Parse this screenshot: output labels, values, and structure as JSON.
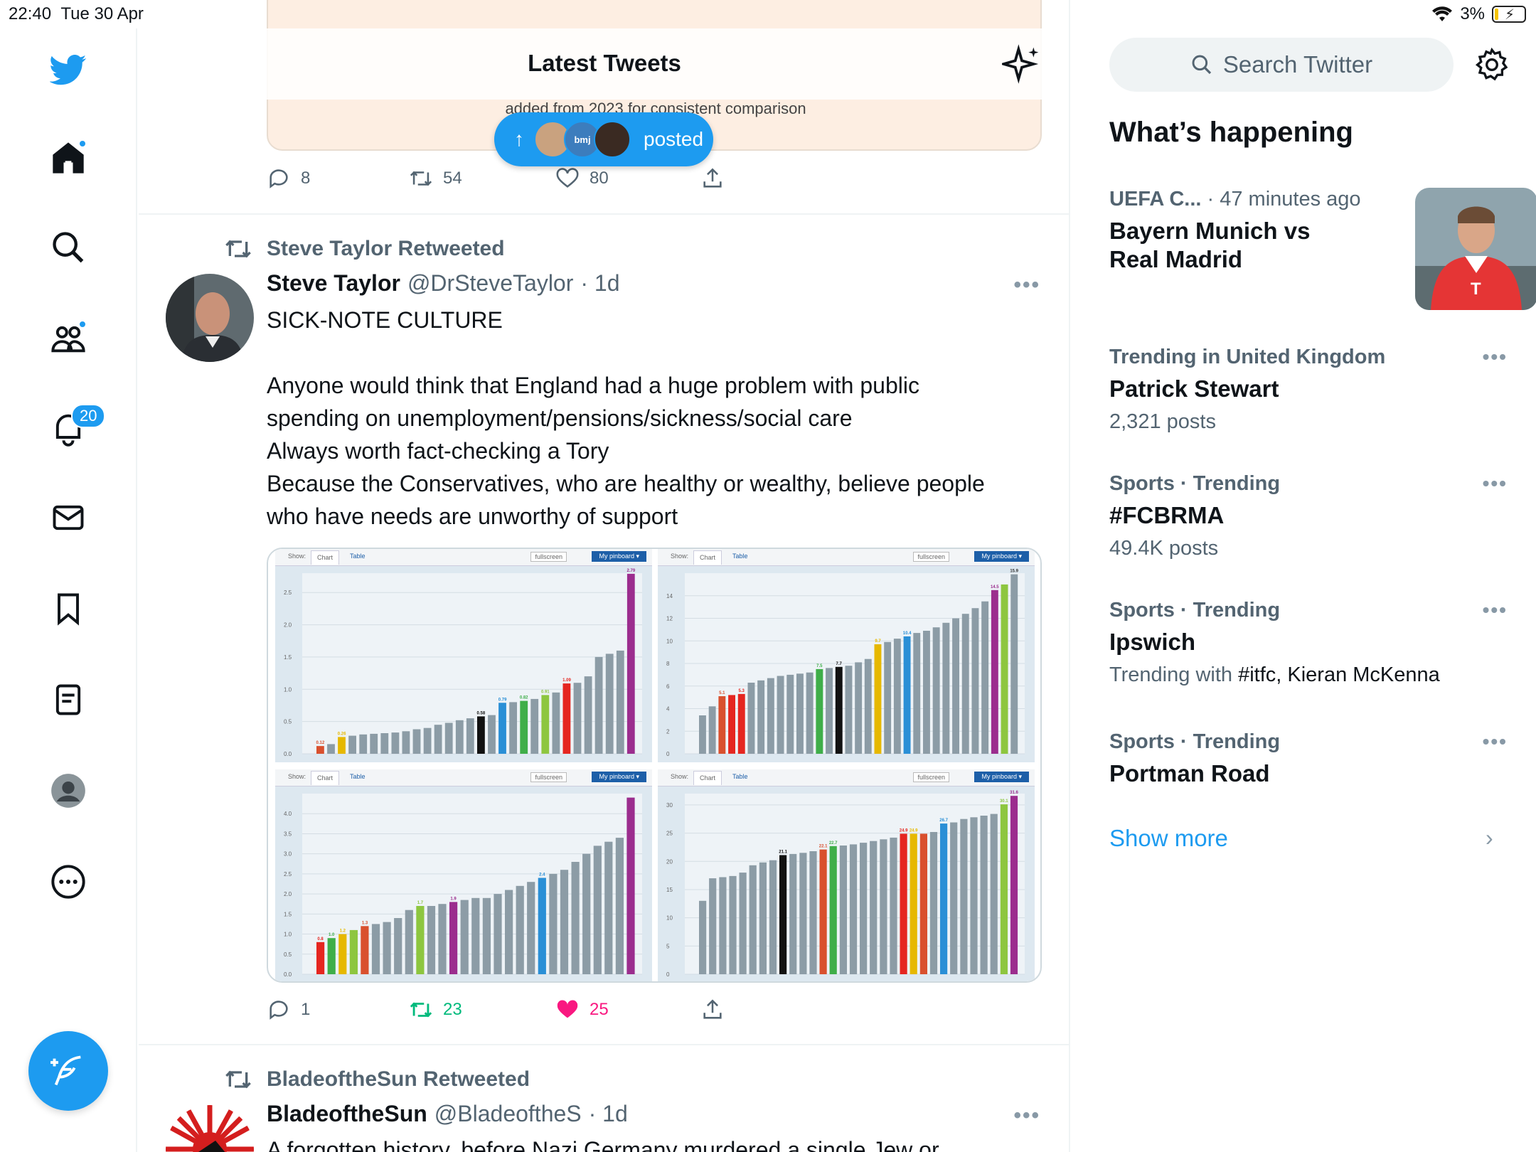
{
  "status": {
    "time": "22:40",
    "date": "Tue 30 Apr",
    "dots": "•••",
    "battery": "3%"
  },
  "nav": {
    "notifications_badge": "20"
  },
  "header": {
    "title": "Latest Tweets"
  },
  "previous_tweet": {
    "card_text": "added from 2023 for consistent comparison",
    "reply_count": "8",
    "retweet_count": "54",
    "like_count": "80"
  },
  "new_posts_pill": {
    "arrow": "↑",
    "label": "posted",
    "avatar_text": "bmj"
  },
  "tweet1": {
    "retweeted_by": "Steve Taylor Retweeted",
    "name": "Steve Taylor",
    "handle": "@DrSteveTaylor",
    "time": "· 1d",
    "more": "•••",
    "lines": [
      "SICK-NOTE CULTURE",
      "Anyone would think that England had a huge problem with public",
      "spending on unemployment/pensions/sickness/social care",
      "Always worth fact-checking a Tory",
      "Because the Conservatives, who are healthy or wealthy, believe people",
      "who have needs are unworthy of support"
    ],
    "reply_count": "1",
    "retweet_count": "23",
    "like_count": "25",
    "like_color": "#f91880",
    "retweet_color": "#00ba7c"
  },
  "chart_toolbar": {
    "show": "Show:",
    "chart": "Chart",
    "table": "Table",
    "fullscreen": "fullscreen",
    "pinboard": "My pinboard ▾"
  },
  "chart_data": [
    {
      "type": "bar",
      "values": [
        0.12,
        0.15,
        0.26,
        0.28,
        0.3,
        0.31,
        0.32,
        0.33,
        0.35,
        0.38,
        0.4,
        0.45,
        0.48,
        0.52,
        0.55,
        0.58,
        0.6,
        0.79,
        0.8,
        0.82,
        0.85,
        0.91,
        0.95,
        1.09,
        1.1,
        1.2,
        1.5,
        1.55,
        1.6,
        2.79
      ],
      "colors_index": {
        "0": "#d9502e",
        "2": "#e6b800",
        "15": "#111111",
        "17": "#2a8fd6",
        "19": "#3fae49",
        "21": "#8dc63f",
        "23": "#e52620",
        "29": "#9b2d8e"
      },
      "labels_index": {
        "0": "0.12",
        "2": "0.26",
        "15": "0.58",
        "17": "0.79",
        "19": "0.82",
        "21": "0.91",
        "23": "1.09",
        "29": "2.79"
      },
      "ylim": [
        0,
        2.8
      ],
      "yticks": [
        "0.0",
        "0.5",
        "1.0",
        "1.5",
        "2.0",
        "2.5"
      ]
    },
    {
      "type": "bar",
      "values": [
        3.4,
        4.2,
        5.1,
        5.2,
        5.3,
        6.3,
        6.5,
        6.7,
        6.9,
        7.0,
        7.1,
        7.2,
        7.5,
        7.6,
        7.7,
        7.8,
        8.1,
        8.4,
        9.7,
        9.9,
        10.2,
        10.4,
        10.7,
        10.9,
        11.2,
        11.6,
        12.0,
        12.4,
        12.9,
        13.5,
        14.5,
        15.0,
        15.9
      ],
      "colors_index": {
        "2": "#d9502e",
        "3": "#e52620",
        "4": "#e52620",
        "12": "#3fae49",
        "14": "#111111",
        "18": "#e6b800",
        "21": "#2a8fd6",
        "30": "#9b2d8e",
        "31": "#8dc63f"
      },
      "labels_index": {
        "2": "5.1",
        "4": "5.3",
        "12": "7.5",
        "14": "7.7",
        "18": "9.7",
        "21": "10.4",
        "30": "14.5",
        "32": "15.9"
      },
      "ylim": [
        0,
        16
      ],
      "yticks": [
        "0",
        "2",
        "4",
        "6",
        "8",
        "10",
        "12",
        "14"
      ]
    },
    {
      "type": "bar",
      "values": [
        0.8,
        0.9,
        1.0,
        1.1,
        1.2,
        1.25,
        1.3,
        1.4,
        1.6,
        1.7,
        1.7,
        1.75,
        1.8,
        1.85,
        1.9,
        1.9,
        2.0,
        2.1,
        2.2,
        2.3,
        2.4,
        2.5,
        2.6,
        2.8,
        3.0,
        3.2,
        3.3,
        3.4,
        4.4
      ],
      "colors_index": {
        "0": "#e52620",
        "1": "#3fae49",
        "2": "#e6b800",
        "3": "#8dc63f",
        "4": "#d9502e",
        "9": "#8dc63f",
        "12": "#9b2d8e",
        "20": "#2a8fd6",
        "28": "#9b2d8e"
      },
      "labels_index": {
        "0": "0.8",
        "1": "1.0",
        "2": "1.2",
        "4": "1.3",
        "9": "1.7",
        "12": "1.9",
        "20": "2.4"
      },
      "ylim": [
        0,
        4.5
      ],
      "yticks": [
        "0.0",
        "0.5",
        "1.0",
        "1.5",
        "2.0",
        "2.5",
        "3.0",
        "3.5",
        "4.0"
      ]
    },
    {
      "type": "bar",
      "values": [
        13,
        17,
        17.2,
        17.4,
        18,
        19.3,
        19.8,
        20.2,
        21.1,
        21.3,
        21.5,
        21.8,
        22.1,
        22.7,
        22.8,
        23.0,
        23.3,
        23.6,
        23.9,
        24.2,
        24.9,
        24.9,
        24.9,
        25.2,
        26.7,
        26.9,
        27.5,
        27.8,
        28.1,
        28.4,
        30.1,
        31.6
      ],
      "colors_index": {
        "8": "#111111",
        "12": "#d9502e",
        "13": "#3fae49",
        "20": "#e52620",
        "21": "#e6b800",
        "22": "#d9502e",
        "24": "#2a8fd6",
        "30": "#8dc63f",
        "31": "#9b2d8e"
      },
      "labels_index": {
        "8": "21.1",
        "12": "22.1",
        "13": "22.7",
        "20": "24.9",
        "21": "24.9",
        "24": "26.7",
        "30": "30.1",
        "31": "31.6"
      },
      "ylim": [
        0,
        32
      ],
      "yticks": [
        "0",
        "5",
        "10",
        "15",
        "20",
        "25",
        "30"
      ]
    }
  ],
  "tweet2": {
    "retweeted_by": "BladeoftheSun Retweeted",
    "name": "BladeoftheSun",
    "handle": "@BladeoftheS",
    "time": "· 1d",
    "more": "•••",
    "text": "A forgotten history, before Nazi Germany murdered a single Jew or"
  },
  "sidebar": {
    "search_placeholder": "Search Twitter",
    "title": "What’s happening",
    "trends": [
      {
        "meta": "UEFA C...",
        "meta_extra": "· 47 minutes ago",
        "topic": "Bayern Munich vs Real Madrid",
        "count": ""
      },
      {
        "meta": "Trending in United Kingdom",
        "meta_extra": "",
        "topic": "Patrick Stewart",
        "count": "2,321 posts"
      },
      {
        "meta": "Sports · Trending",
        "meta_extra": "",
        "topic": "#FCBRMA",
        "count": "49.4K posts"
      },
      {
        "meta": "Sports · Trending",
        "meta_extra": "",
        "topic": "Ipswich",
        "count": "Trending with",
        "count_tags": "#itfc, Kieran McKenna"
      },
      {
        "meta": "Sports · Trending",
        "meta_extra": "",
        "topic": "Portman Road",
        "count": ""
      }
    ],
    "trend_more": "•••",
    "show_more": "Show more",
    "show_more_chevron": "›"
  }
}
